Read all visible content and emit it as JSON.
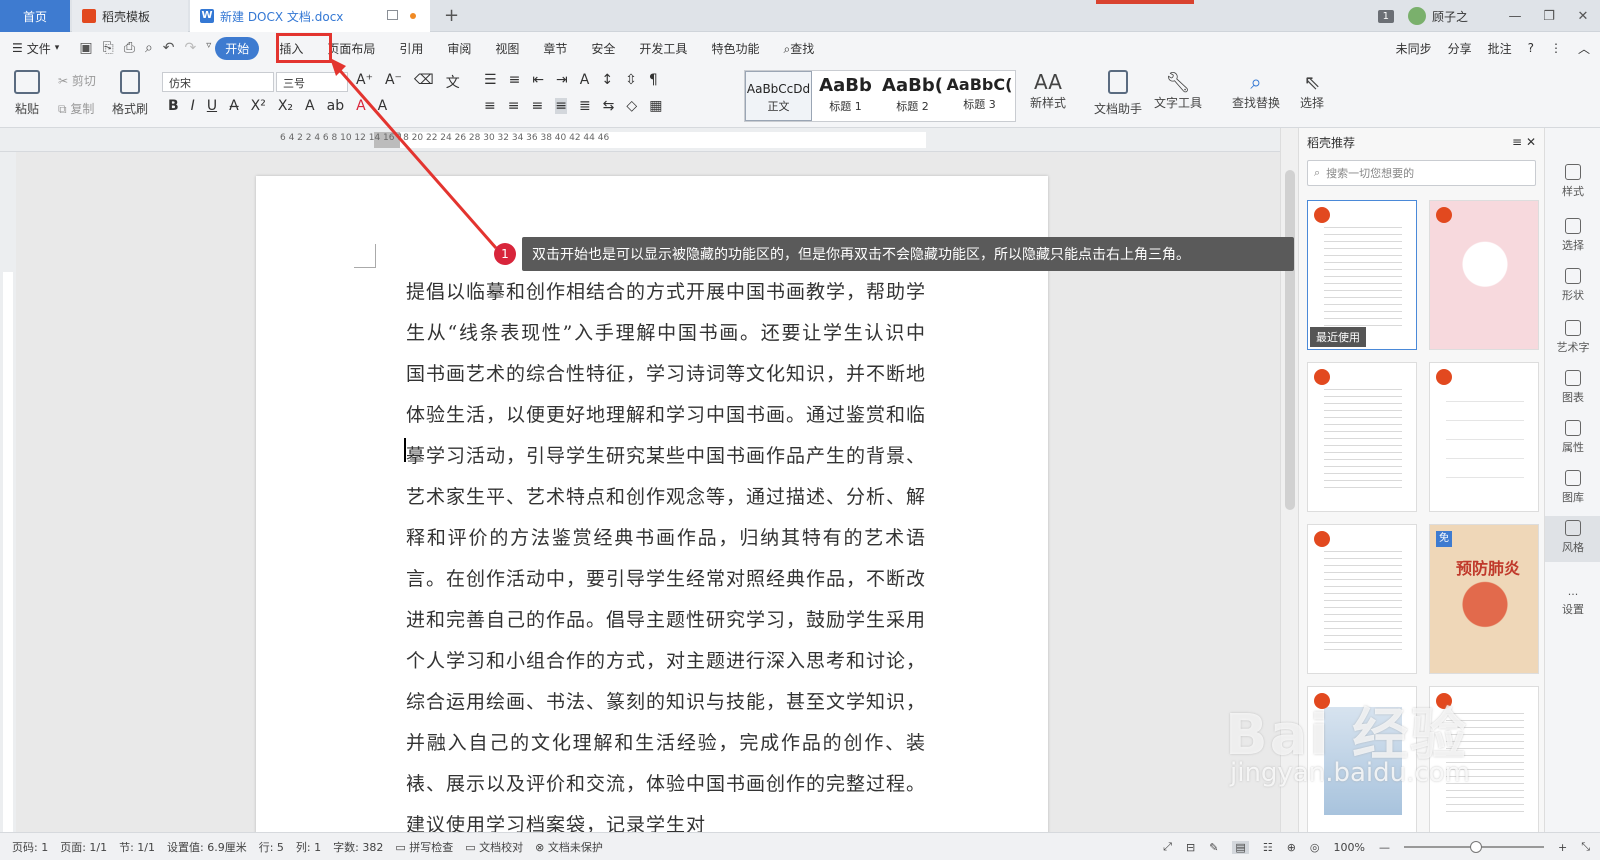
{
  "tabs": {
    "home": "首页",
    "template": "稻壳模板",
    "document": "新建 DOCX 文档.docx",
    "add": "+"
  },
  "window": {
    "badge": "1",
    "user": "顾子之",
    "minimize": "—",
    "restore": "❐",
    "close": "✕"
  },
  "menu": {
    "file": "文件",
    "items": [
      "开始",
      "插入",
      "页面布局",
      "引用",
      "审阅",
      "视图",
      "章节",
      "安全",
      "开发工具",
      "特色功能"
    ],
    "search": "查找",
    "right": [
      "未同步",
      "分享",
      "批注",
      "?",
      "⋮",
      "︿"
    ]
  },
  "ribbon": {
    "paste": "粘贴",
    "cut": "剪切",
    "copy": "复制",
    "format_painter": "格式刷",
    "font_name": "仿宋",
    "font_size": "三号",
    "styles": [
      {
        "sample": "AaBbCcDd",
        "label": "正文"
      },
      {
        "sample": "AaBb",
        "label": "标题 1"
      },
      {
        "sample": "AaBb(",
        "label": "标题 2"
      },
      {
        "sample": "AaBbC(",
        "label": "标题 3"
      }
    ],
    "new_style": "新样式",
    "doc_assistant": "文档助手",
    "text_tools": "文字工具",
    "find_replace": "查找替换",
    "select": "选择"
  },
  "ruler": {
    "numbers": "6    4    2         2    4    6    8    10   12   14   16   18   20   22   24   26   28   30   32   34   36   38   40   42   44   46"
  },
  "document": {
    "paragraph": "提倡以临摹和创作相结合的方式开展中国书画教学，帮助学生从“线条表现性”入手理解中国书画。还要让学生认识中国书画艺术的综合性特征，学习诗词等文化知识，并不断地体验生活，以便更好地理解和学习中国书画。通过鉴赏和临摹学习活动，引导学生研究某些中国书画作品产生的背景、艺术家生平、艺术特点和创作观念等，通过描述、分析、解释和评价的方法鉴赏经典书画作品，归纳其特有的艺术语言。在创作活动中，要引导学生经常对照经典作品，不断改进和完善自己的作品。倡导主题性研究学习，鼓励学生采用个人学习和小组合作的方式，对主题进行深入思考和讨论，综合运用绘画、书法、篆刻的知识与技能，甚至文学知识，并融入自己的文化理解和生活经验，完成作品的创作、装裱、展示以及评价和交流，体验中国书画创作的完整过程。建议使用学习档案袋，记录学生对"
  },
  "annotation": {
    "number": "1",
    "text": "双击开始也是可以显示被隐藏的功能区的，但是你再双击不会隐藏功能区，所以隐藏只能点击右上角三角。"
  },
  "panel": {
    "title": "稻壳推荐",
    "search_placeholder": "搜索一切您想要的",
    "recent_label": "最近使用",
    "free_badge": "免",
    "poster_title": "预防肺炎"
  },
  "sidetools": [
    "样式",
    "选择",
    "形状",
    "艺术字",
    "图表",
    "属性",
    "图库",
    "风格",
    "设置"
  ],
  "status": {
    "page_num": "页码: 1",
    "pages": "页面: 1/1",
    "section": "节: 1/1",
    "setting": "设置值: 6.9厘米",
    "row": "行: 5",
    "col": "列: 1",
    "words": "字数: 382",
    "spell": "拼写检查",
    "proof": "文档校对",
    "protect": "文档未保护",
    "zoom": "100%"
  },
  "watermark": {
    "main": "Bai 经验",
    "sub": "jingyan.baidu.com"
  },
  "colors": {
    "accent": "#3e7bd0",
    "highlight_box": "#e3342f",
    "annotation_bg": "#5a5a5a"
  }
}
